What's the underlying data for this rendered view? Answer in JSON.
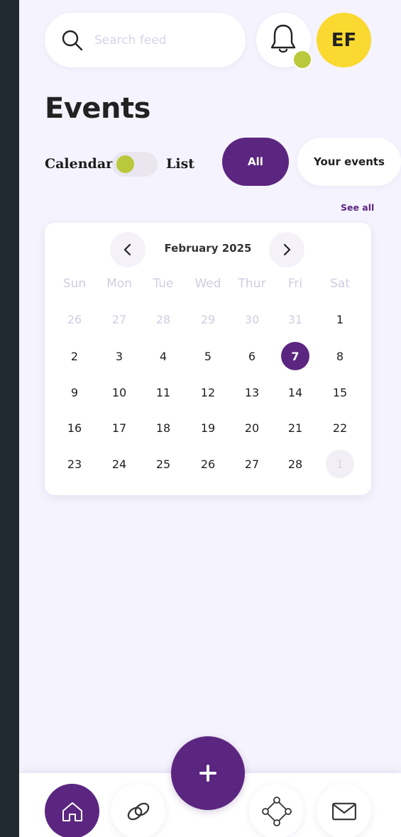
{
  "search": {
    "placeholder": "Search feed",
    "icon": "search-icon"
  },
  "header": {
    "bell_icon": "bell-icon",
    "avatar_initials": "EF",
    "status_dot_color": "#bac83b",
    "avatar_color": "#fad930"
  },
  "page": {
    "title": "Events"
  },
  "view_toggle": {
    "left_label": "Calendar",
    "right_label": "List"
  },
  "filters": {
    "all_label": "All",
    "your_events_label": "Your events",
    "active": "All"
  },
  "see_all_label": "See all",
  "calendar": {
    "month_label": "February 2025",
    "weekdays": [
      "Sun",
      "Mon",
      "Tue",
      "Wed",
      "Thur",
      "Fri",
      "Sat"
    ],
    "weeks": [
      [
        "26",
        "27",
        "28",
        "29",
        "30",
        "31",
        "1"
      ],
      [
        "2",
        "3",
        "4",
        "5",
        "6",
        "7",
        "8"
      ],
      [
        "9",
        "10",
        "11",
        "12",
        "13",
        "14",
        "15"
      ],
      [
        "16",
        "17",
        "18",
        "19",
        "20",
        "21",
        "22"
      ],
      [
        "23",
        "24",
        "25",
        "26",
        "27",
        "28",
        "1"
      ]
    ],
    "selected_day": "7"
  },
  "bottom_nav": {
    "items": [
      "home-icon",
      "link-icon",
      "add-icon",
      "network-icon",
      "mail-icon"
    ],
    "fab_label": "+",
    "active": "home-icon"
  },
  "colors": {
    "accent": "#5b2680",
    "background": "#f5f3fd",
    "lime": "#bac83b"
  }
}
